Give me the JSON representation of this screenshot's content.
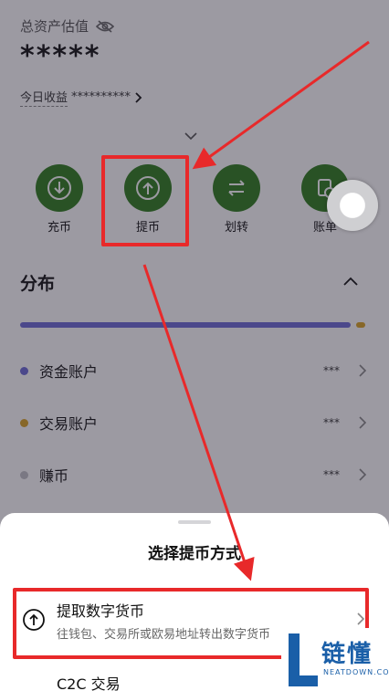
{
  "asset": {
    "label": "总资产估值",
    "value": "*****",
    "income_label": "今日收益",
    "income_value": "**********"
  },
  "actions": [
    {
      "label": "充币",
      "icon": "deposit-icon"
    },
    {
      "label": "提币",
      "icon": "withdraw-icon"
    },
    {
      "label": "划转",
      "icon": "transfer-icon"
    },
    {
      "label": "账单",
      "icon": "bill-icon"
    }
  ],
  "distribution": {
    "title": "分布",
    "accounts": [
      {
        "name": "资金账户",
        "value": "***",
        "color": "#6c6bd6"
      },
      {
        "name": "交易账户",
        "value": "***",
        "color": "#d9a321"
      },
      {
        "name": "赚币",
        "value": "***",
        "color": "#c2c2c6"
      }
    ]
  },
  "sheet": {
    "title": "选择提币方式",
    "options": [
      {
        "title": "提取数字货币",
        "subtitle": "往钱包、交易所或欧易地址转出数字货币"
      },
      {
        "title": "C2C 交易"
      }
    ]
  },
  "watermark": {
    "text": "链懂",
    "sub": "NEATDOWN.COM"
  },
  "colors": {
    "action_green": "#2e7d1c",
    "highlight_red": "#e8292a"
  }
}
